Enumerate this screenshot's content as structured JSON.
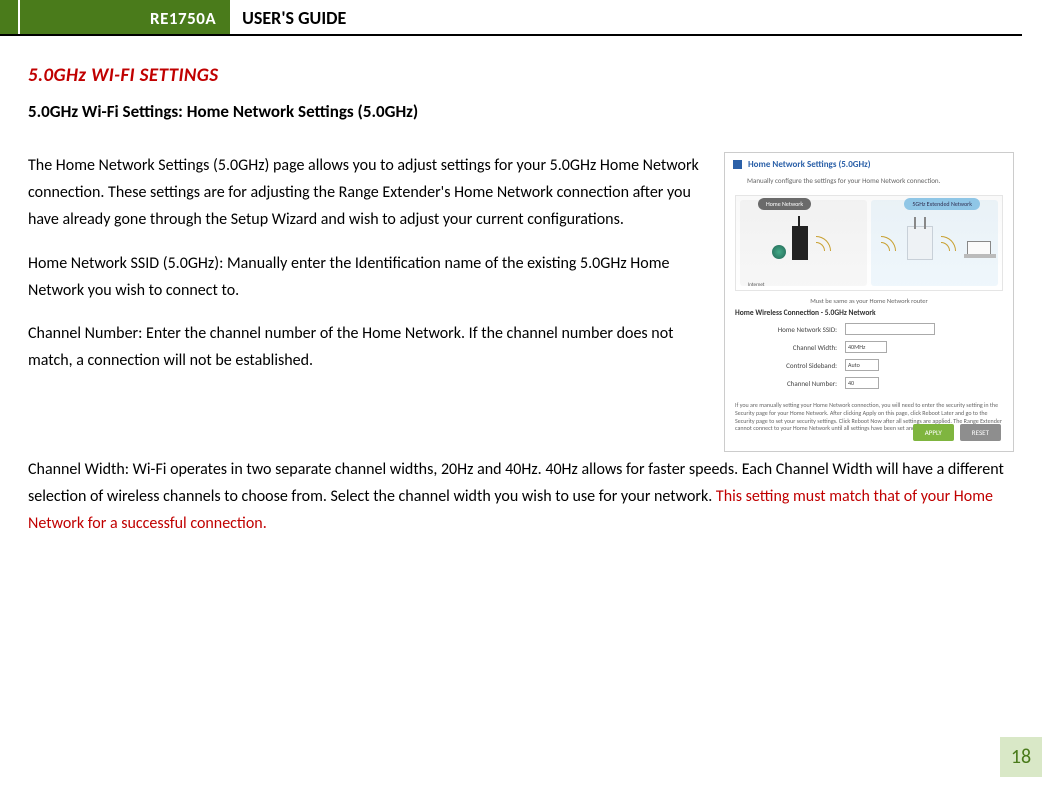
{
  "header": {
    "product": "RE1750A",
    "guide": "USER'S GUIDE"
  },
  "section": {
    "title": "5.0GHz WI-FI SETTINGS",
    "subtitle": "5.0GHz Wi-Fi Settings: Home Network Settings (5.0GHz)"
  },
  "paragraphs": {
    "p1": "The Home Network Settings (5.0GHz) page allows you to adjust settings for your 5.0GHz Home Network connection. These settings are for adjusting the Range Extender's Home Network connection after you have already gone through the Setup Wizard and wish to adjust your current configurations.",
    "p2": "Home Network SSID (5.0GHz): Manually enter the Identification name of the existing 5.0GHz Home Network you wish to connect to.",
    "p3": "Channel Number: Enter the channel number of the Home Network. If the channel number does not match, a connection will not be established.",
    "p4a": "Channel Width: Wi-Fi operates in two separate channel widths, 20Hz and 40Hz. 40Hz allows for faster speeds. Each Channel Width will have a different selection of wireless channels to choose from. Select the channel width you wish to use for your network. ",
    "p4b": "This setting must match that of your Home Network for a successful connection."
  },
  "figure": {
    "title": "Home Network Settings (5.0GHz)",
    "subtitle": "Manually configure the settings for your Home Network connection.",
    "pill_left": "Home Network",
    "pill_right": "5GHz Extended Network",
    "internet": "Internet",
    "router": "Router",
    "diagram_caption": "Must be same as your Home Network router",
    "conn_title": "Home Wireless Connection - 5.0GHz Network",
    "rows": {
      "ssid_label": "Home Network SSID:",
      "width_label": "Channel Width:",
      "width_value": "40MHz",
      "sideband_label": "Control Sideband:",
      "sideband_value": "Auto",
      "chan_label": "Channel Number:",
      "chan_value": "40"
    },
    "fine_print": "If you are manually setting your Home Network connection, you will need to enter the security setting in the Security page for your Home Network. After clicking Apply on this page, click Reboot Later and go to the Security page to set your security settings. Click Reboot Now after all settings are applied. The Range Extender cannot connect to your Home Network until all settings have been set and applied.",
    "apply": "APPLY",
    "reset": "RESET"
  },
  "page_number": "18"
}
